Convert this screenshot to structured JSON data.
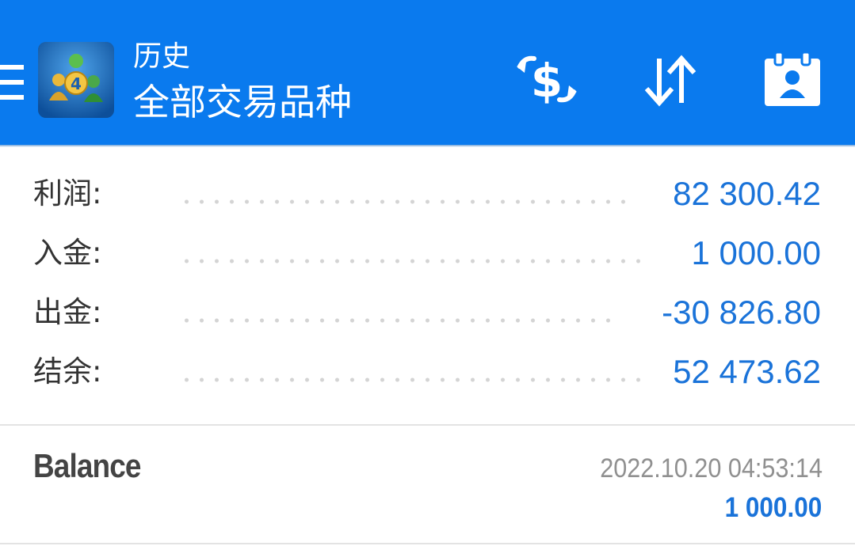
{
  "header": {
    "title": "历史",
    "subtitle": "全部交易品种",
    "logo_label": "4",
    "background_color": "#0a7aee",
    "icons": {
      "menu": "menu-icon",
      "trade": "dollar-exchange-icon",
      "sort": "sort-arrows-icon",
      "account": "account-card-icon"
    }
  },
  "summary": {
    "rows": [
      {
        "label": "利润:",
        "value": "82 300.42"
      },
      {
        "label": "入金:",
        "value": "1 000.00"
      },
      {
        "label": "出金:",
        "value": "-30 826.80"
      },
      {
        "label": "结余:",
        "value": "52 473.62"
      }
    ],
    "value_color": "#1a73d9"
  },
  "deals": [
    {
      "type": "Balance",
      "time": "2022.10.20 04:53:14",
      "amount": "1 000.00"
    }
  ]
}
